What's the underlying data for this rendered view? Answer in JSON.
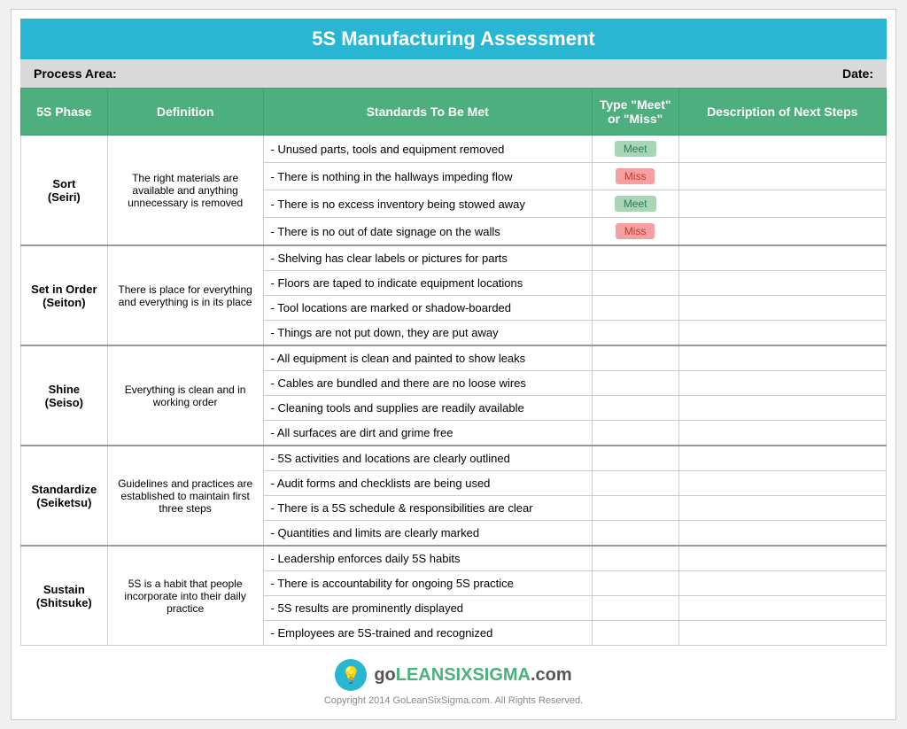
{
  "title": "5S Manufacturing Assessment",
  "meta": {
    "process_area_label": "Process Area:",
    "date_label": "Date:"
  },
  "headers": {
    "phase": "5S Phase",
    "definition": "Definition",
    "standards": "Standards To Be Met",
    "type": "Type \"Meet\" or \"Miss\"",
    "next_steps": "Description of Next Steps"
  },
  "phases": [
    {
      "phase": "Sort\n(Seiri)",
      "definition": "The right materials are available and anything unnecessary is removed",
      "standards": [
        {
          "text": "- Unused parts, tools and equipment removed",
          "type": "Meet"
        },
        {
          "text": "- There is nothing in the hallways impeding flow",
          "type": "Miss"
        },
        {
          "text": "- There is no excess inventory being stowed away",
          "type": "Meet"
        },
        {
          "text": "- There is no out of date signage on the walls",
          "type": "Miss"
        }
      ]
    },
    {
      "phase": "Set in Order\n(Seiton)",
      "definition": "There is place for everything and everything is in its place",
      "standards": [
        {
          "text": "- Shelving has clear labels or pictures for parts",
          "type": ""
        },
        {
          "text": "- Floors are taped to indicate equipment locations",
          "type": ""
        },
        {
          "text": "- Tool locations are marked or shadow-boarded",
          "type": ""
        },
        {
          "text": "- Things are not put down, they are put away",
          "type": ""
        }
      ]
    },
    {
      "phase": "Shine\n(Seiso)",
      "definition": "Everything is clean and in working order",
      "standards": [
        {
          "text": "- All equipment is clean and painted to show leaks",
          "type": ""
        },
        {
          "text": "- Cables are bundled and there are no loose wires",
          "type": ""
        },
        {
          "text": "- Cleaning tools and supplies are readily available",
          "type": ""
        },
        {
          "text": "- All surfaces are dirt and grime free",
          "type": ""
        }
      ]
    },
    {
      "phase": "Standardize\n(Seiketsu)",
      "definition": "Guidelines and practices are established to maintain first three steps",
      "standards": [
        {
          "text": "- 5S activities and locations are clearly outlined",
          "type": ""
        },
        {
          "text": "- Audit forms and checklists are being used",
          "type": ""
        },
        {
          "text": "- There is a 5S schedule & responsibilities are clear",
          "type": ""
        },
        {
          "text": "- Quantities and limits are clearly marked",
          "type": ""
        }
      ]
    },
    {
      "phase": "Sustain\n(Shitsuke)",
      "definition": "5S is a habit that people incorporate into their daily practice",
      "standards": [
        {
          "text": "- Leadership enforces daily 5S habits",
          "type": ""
        },
        {
          "text": "- There is accountability for ongoing 5S practice",
          "type": ""
        },
        {
          "text": "- 5S results are prominently displayed",
          "type": ""
        },
        {
          "text": "- Employees are 5S-trained and recognized",
          "type": ""
        }
      ]
    }
  ],
  "footer": {
    "logo_text": "goLEANSIXSIGMA.com",
    "copyright": "Copyright 2014 GoLeanSixSigma.com. All Rights Reserved."
  }
}
